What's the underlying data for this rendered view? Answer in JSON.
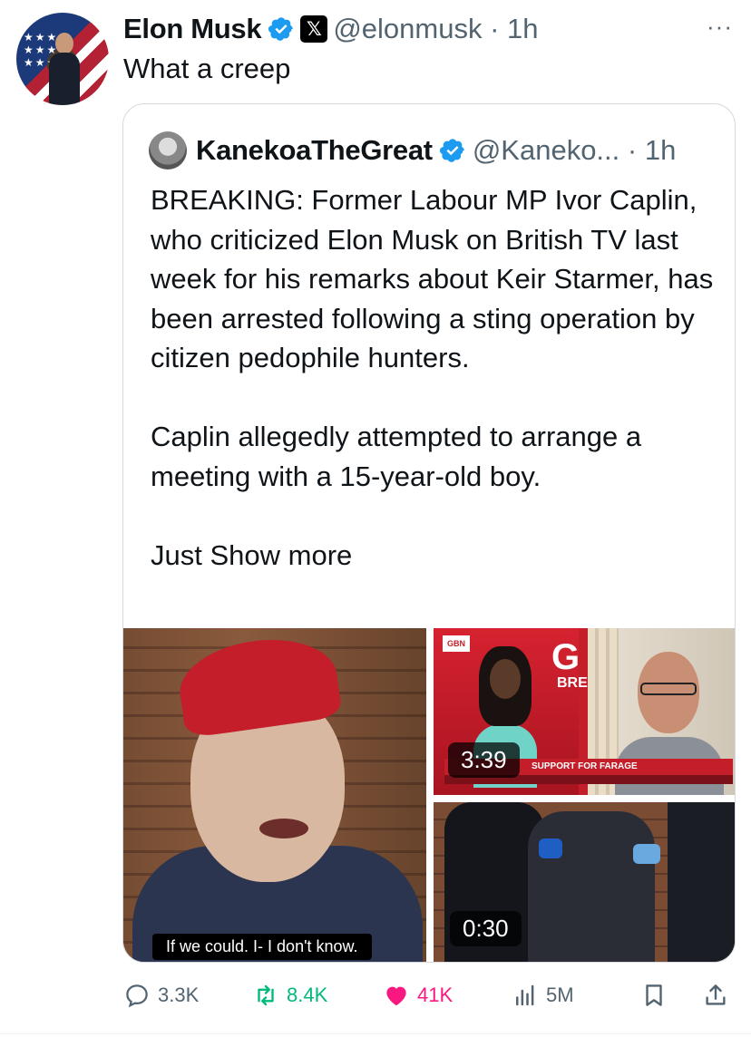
{
  "post": {
    "author_name": "Elon Musk",
    "handle_time": "@elonmusk · 1h",
    "text": "What a creep",
    "more_menu": "···"
  },
  "quote": {
    "author_name": "KanekoaTheGreat",
    "handle_time": "@Kaneko... · 1h",
    "text": "BREAKING: Former Labour MP Ivor Caplin, who criticized Elon Musk on British TV last week for his remarks about Keir Starmer, has been arrested following a sting operation by citizen pedophile hunters.\n\nCaplin allegedly attempted to arrange a meeting with a 15-year-old boy.\n\nJust Show more",
    "media": [
      {
        "caption": "If we could. I- I don't know."
      },
      {
        "duration": "3:39",
        "channel": "GBN",
        "headline": "G",
        "sub": "BRE",
        "banner": "SUPPORT FOR FARAGE"
      },
      {
        "duration": "0:30"
      }
    ]
  },
  "actions": {
    "replies": "3.3K",
    "reposts": "8.4K",
    "likes": "41K",
    "views": "5M"
  },
  "colors": {
    "verified": "#1d9bf0",
    "repost": "#00ba7c",
    "like": "#f91880",
    "muted": "#536471"
  },
  "icons": [
    "verified-badge-icon",
    "x-premium-badge-icon",
    "reply-icon",
    "repost-icon",
    "like-icon",
    "views-icon",
    "bookmark-icon",
    "share-icon"
  ]
}
